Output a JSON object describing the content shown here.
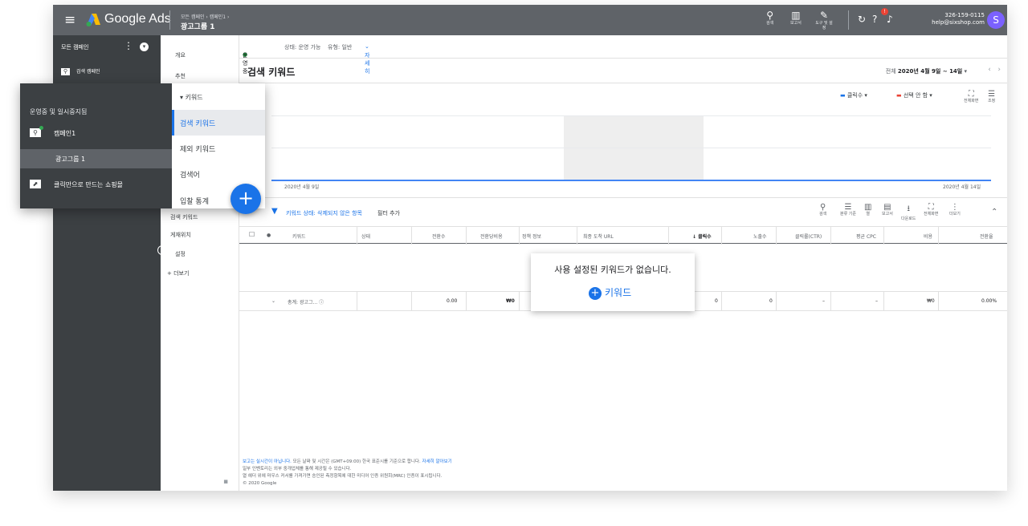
{
  "topbar": {
    "brand": "Google Ads",
    "breadcrumb": "모든 캠페인 › 캠페인1 ›",
    "adgroup": "광고그룹 1",
    "search": "검색",
    "reports": "보고서",
    "tools": "도구 및 설정",
    "bell_badge": "!",
    "phone": "326-159-0115",
    "email": "help@sixshop.com",
    "avatar": "S"
  },
  "leftnav": {
    "all_campaigns": "모든 캠페인",
    "search_campaign": "검색 캠페인"
  },
  "subnav": {
    "items": [
      "개요",
      "추천",
      "검색 키워드",
      "게재위치",
      "설정"
    ],
    "more": "더보기"
  },
  "status": {
    "state": "운영중",
    "status": "상태: 운영 가능",
    "type": "유형: 일반",
    "detail": "자세히"
  },
  "header": {
    "title": "검색 키워드",
    "range_label": "전체",
    "range": "2020년 4월 9일 ~ 14일"
  },
  "chart_data": {
    "type": "line",
    "x": [
      "2020년 4월 9일",
      "2020년 4월 14일"
    ],
    "series": [
      {
        "name": "클릭수",
        "values": [
          0,
          0
        ]
      }
    ],
    "yticks": [
      "2",
      "1",
      "0"
    ],
    "legend": [
      "클릭수",
      "선택 안 함"
    ],
    "colors": {
      "clicks": "#1a73e8",
      "none": "#ea4335"
    }
  },
  "chart_tools": {
    "fullscreen": "전체화면",
    "adjust": "조정"
  },
  "filter": {
    "label": "키워드 상태: 삭제되지 않은 항목",
    "add": "필터 추가"
  },
  "table_tools": {
    "search": "검색",
    "segment": "분류 기준",
    "columns": "열",
    "reports": "보고서",
    "download": "다운로드",
    "fullscreen": "전체화면",
    "more": "더보기"
  },
  "table": {
    "headers": [
      "키워드",
      "상태",
      "전환수",
      "전환당비용",
      "정책 정보",
      "최종 도착 URL",
      "↓ 클릭수",
      "노출수",
      "클릭률(CTR)",
      "평균 CPC",
      "비용",
      "전환율"
    ],
    "total": {
      "label": "총계: 광고그...",
      "conversions": "0.00",
      "cost_per_conv": "₩0",
      "clicks": "0",
      "impressions": "0",
      "ctr": "–",
      "cpc": "–",
      "cost": "₩0",
      "conv_rate": "0.00%"
    }
  },
  "popup": {
    "message": "사용 설정된 키워드가 없습니다.",
    "add": "키워드"
  },
  "footer": {
    "link1": "보고는 실시간이 아닙니다.",
    "line1": " 모든 날짜 및 시간은 (GMT+09:00) 한국 표준시를 기준으로 합니다. ",
    "link2": "자세히 알아보기",
    "line2": "일부 인벤토리는 외부 중개업체를 통해 제공될 수 있습니다.",
    "line3": "열 헤더 위에 마우스 커서를 가져가면 승인된 측정항목에 대한 미디어 인증 위원회(MRC) 인증이 표시됩니다.",
    "copyright": "© 2020 Google"
  },
  "overlay": {
    "header": "운영중 및 일시중지됨",
    "campaign": "캠페인1",
    "adgroup": "광고그룹 1",
    "shopping": "클릭만으로 만드는 쇼핑몰",
    "menu": {
      "keywords": "키워드",
      "search_kw": "검색 키워드",
      "negative": "제외 키워드",
      "search_terms": "검색어",
      "auction": "입찰 통계"
    },
    "fab": "+"
  }
}
